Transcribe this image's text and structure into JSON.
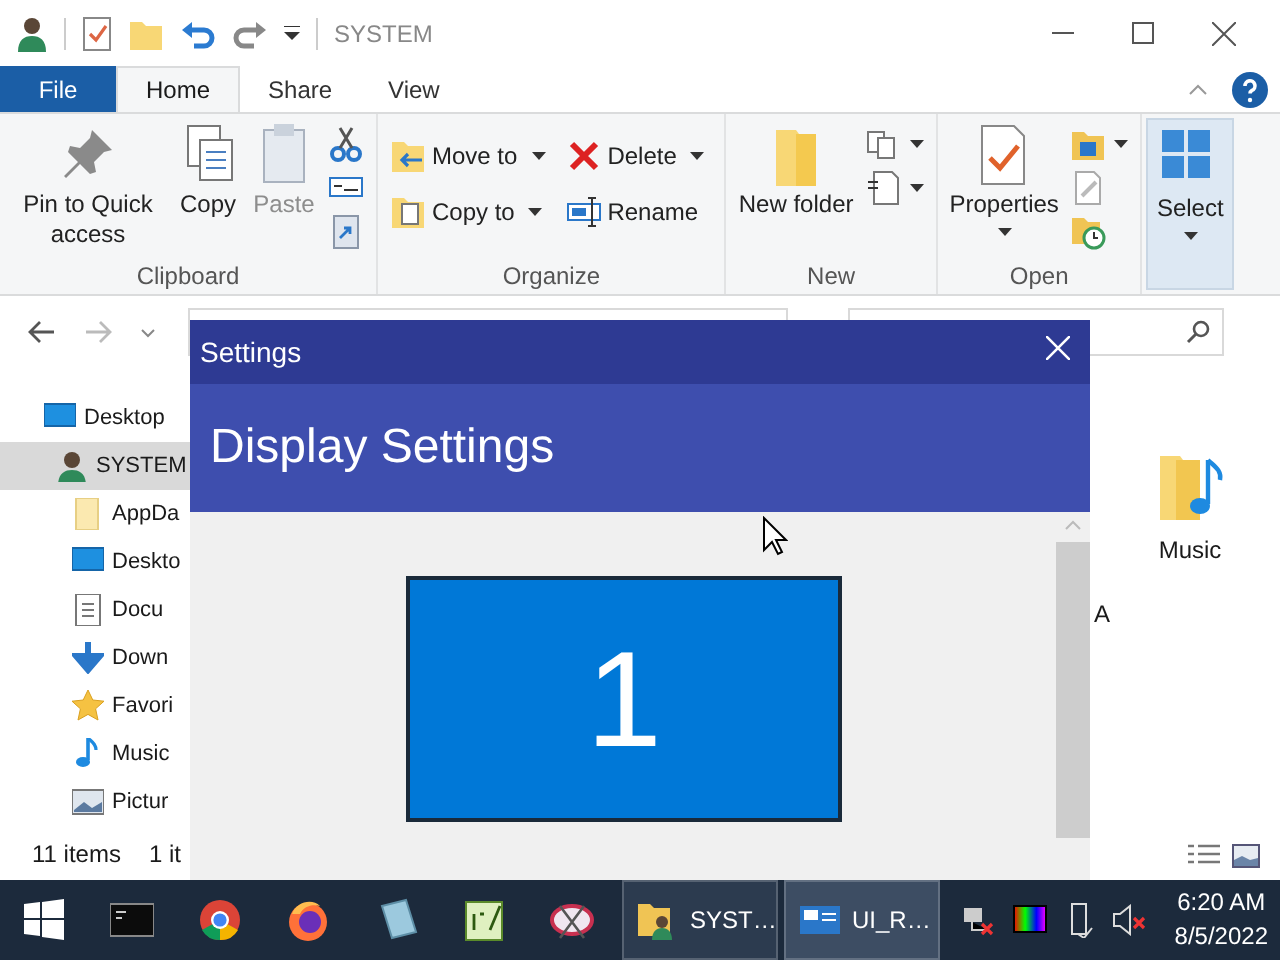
{
  "explorer": {
    "title": "SYSTEM",
    "ribbon_tabs": [
      {
        "label": "File",
        "kind": "file",
        "selected": false
      },
      {
        "label": "Home",
        "kind": "tab",
        "selected": true
      },
      {
        "label": "Share",
        "kind": "tab",
        "selected": false
      },
      {
        "label": "View",
        "kind": "tab",
        "selected": false
      }
    ],
    "ribbon_groups": [
      {
        "label": "Clipboard",
        "commands": [
          {
            "label": "Pin to Quick access",
            "kind": "large",
            "disabled": false,
            "dropdown": false
          },
          {
            "label": "Copy",
            "kind": "large",
            "disabled": false,
            "dropdown": false
          },
          {
            "label": "Paste",
            "kind": "large",
            "disabled": true,
            "dropdown": false
          }
        ]
      },
      {
        "label": "Organize",
        "commands": [
          {
            "label": "Move to",
            "kind": "small",
            "disabled": false,
            "dropdown": true
          },
          {
            "label": "Copy to",
            "kind": "small",
            "disabled": false,
            "dropdown": true
          },
          {
            "label": "Delete",
            "kind": "small",
            "disabled": false,
            "dropdown": true
          },
          {
            "label": "Rename",
            "kind": "small",
            "disabled": false,
            "dropdown": false
          }
        ]
      },
      {
        "label": "New",
        "commands": [
          {
            "label": "New folder",
            "kind": "large",
            "disabled": false,
            "dropdown": false
          }
        ]
      },
      {
        "label": "Open",
        "commands": [
          {
            "label": "Properties",
            "kind": "large",
            "disabled": false,
            "dropdown": true
          }
        ]
      },
      {
        "commands": [
          {
            "label": "Select",
            "kind": "large",
            "disabled": false,
            "dropdown": true
          }
        ]
      }
    ],
    "nav_tree": [
      {
        "label": "Desktop",
        "selected": false,
        "children": [
          {
            "label": "SYSTEM",
            "selected": true,
            "children": [
              {
                "label": "AppDa",
                "selected": false
              },
              {
                "label": "Deskto",
                "selected": false
              },
              {
                "label": "Docu",
                "selected": false
              },
              {
                "label": "Down",
                "selected": false
              },
              {
                "label": "Favori",
                "selected": false
              },
              {
                "label": "Music",
                "selected": false
              },
              {
                "label": "Pictur",
                "selected": false
              }
            ]
          }
        ]
      }
    ],
    "files": [
      {
        "label": "Music"
      }
    ],
    "column_text": "A",
    "status_bar": {
      "item_count": "11 items",
      "selection": "1 it"
    }
  },
  "settings_dialog": {
    "title": "Settings",
    "heading": "Display Settings",
    "monitors": [
      {
        "label": "1"
      }
    ]
  },
  "taskbar": {
    "windows": [
      {
        "label": "SYST…",
        "selected": false
      },
      {
        "label": "UI_R…",
        "selected": true
      }
    ],
    "time": "6:20 AM",
    "date": "8/5/2022"
  }
}
